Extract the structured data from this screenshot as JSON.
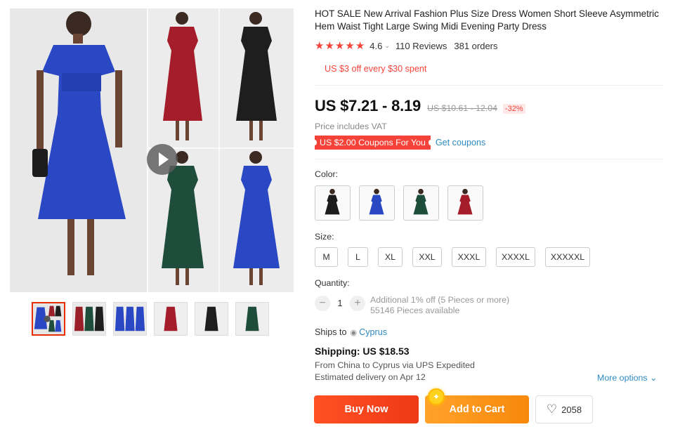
{
  "product": {
    "title": "HOT SALE New Arrival Fashion Plus Size Dress Women Short Sleeve Asymmetric Hem Waist Tight Large Swing Midi Evening Party Dress",
    "rating": "4.6",
    "rating_chevron": "⌄",
    "reviews": "110 Reviews",
    "orders": "381 orders",
    "promo": "US $3 off every $30 spent",
    "price": "US $7.21 - 8.19",
    "old_price": "US $10.61 - 12.04",
    "discount": "-32%",
    "vat_note": "Price includes VAT",
    "coupon_tag": "US $2.00 Coupons For You",
    "get_coupons": "Get coupons"
  },
  "gallery": {
    "main_image_icon": "dress-collage-image",
    "play_icon": "play-icon",
    "thumbnail_colors": [
      "#2a48c4",
      "#9a1f28",
      "#2a48c4",
      "#a51d2a",
      "#1e1e1e",
      "#1f4d3b"
    ]
  },
  "options": {
    "color_label": "Color:",
    "colors": [
      {
        "name": "black",
        "hex": "#1c1c1c"
      },
      {
        "name": "blue",
        "hex": "#2a48c4"
      },
      {
        "name": "green",
        "hex": "#1f4d3b"
      },
      {
        "name": "red",
        "hex": "#a51d2a"
      }
    ],
    "size_label": "Size:",
    "sizes": [
      "M",
      "L",
      "XL",
      "XXL",
      "XXXL",
      "XXXXL",
      "XXXXXL"
    ],
    "quantity_label": "Quantity:",
    "quantity": "1",
    "qty_minus": "−",
    "qty_plus": "+",
    "bulk_note": "Additional 1% off (5 Pieces or more)",
    "available": "55146 Pieces available"
  },
  "shipping": {
    "ships_to_label": "Ships to",
    "country": "Cyprus",
    "title": "Shipping: US $18.53",
    "route": "From China to Cyprus via UPS Expedited",
    "delivery": "Estimated delivery on Apr 12",
    "more_options": "More options",
    "more_chevron": "⌄"
  },
  "actions": {
    "buy_now": "Buy Now",
    "add_to_cart": "Add to Cart",
    "wishlist_count": "2058",
    "heart_icon": "♡",
    "coin_icon": "✦"
  },
  "colors": {
    "accent_red": "#f5433a",
    "link_blue": "#2e8bc0",
    "buy_orange": "#ff5023",
    "cart_orange": "#ffa22a"
  }
}
